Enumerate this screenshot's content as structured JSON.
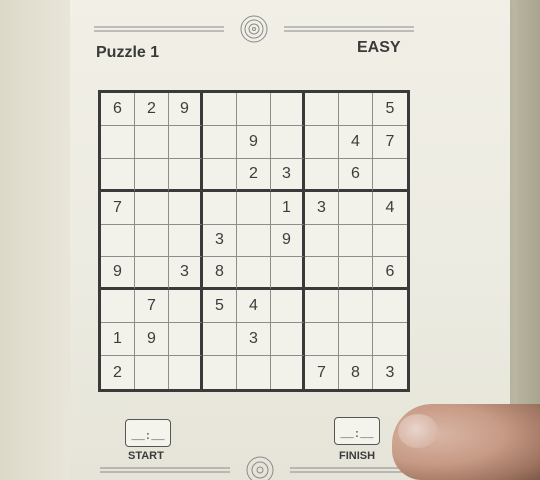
{
  "puzzle": {
    "title": "Puzzle 1",
    "difficulty": "EASY",
    "grid": [
      [
        "6",
        "2",
        "9",
        "",
        "",
        "",
        "",
        "",
        "5"
      ],
      [
        "",
        "",
        "",
        "",
        "9",
        "",
        "",
        "4",
        "7"
      ],
      [
        "",
        "",
        "",
        "",
        "2",
        "3",
        "",
        "6",
        ""
      ],
      [
        "7",
        "",
        "",
        "",
        "",
        "1",
        "3",
        "",
        "4"
      ],
      [
        "",
        "",
        "",
        "3",
        "",
        "9",
        "",
        "",
        ""
      ],
      [
        "9",
        "",
        "3",
        "8",
        "",
        "",
        "",
        "",
        "6"
      ],
      [
        "",
        "7",
        "",
        "5",
        "4",
        "",
        "",
        "",
        ""
      ],
      [
        "1",
        "9",
        "",
        "",
        "3",
        "",
        "",
        "",
        ""
      ],
      [
        "2",
        "",
        "",
        "",
        "",
        "",
        "7",
        "8",
        "3"
      ]
    ]
  },
  "timer": {
    "start_label": "START",
    "finish_label": "FINISH",
    "start_value": "__:__",
    "finish_value": "__:__"
  }
}
